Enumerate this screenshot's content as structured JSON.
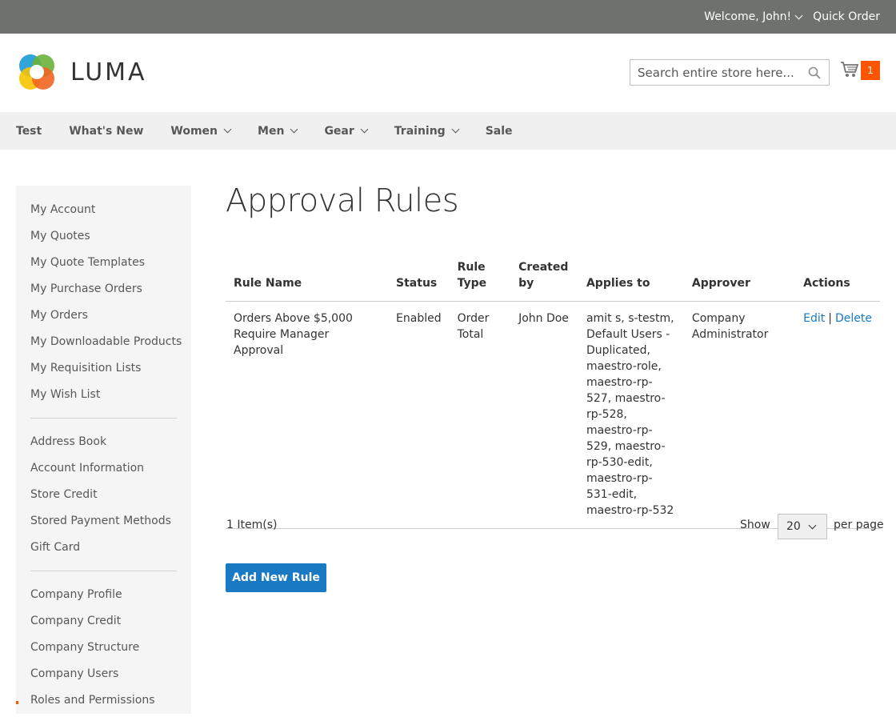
{
  "topbar": {
    "welcome": "Welcome, John!",
    "quick_order": "Quick Order"
  },
  "header": {
    "logo_text": "LUMA",
    "search_placeholder": "Search entire store here...",
    "cart_count": "1"
  },
  "nav": {
    "items": [
      {
        "label": "Test",
        "has_menu": false
      },
      {
        "label": "What's New",
        "has_menu": false
      },
      {
        "label": "Women",
        "has_menu": true
      },
      {
        "label": "Men",
        "has_menu": true
      },
      {
        "label": "Gear",
        "has_menu": true
      },
      {
        "label": "Training",
        "has_menu": true
      },
      {
        "label": "Sale",
        "has_menu": false
      }
    ]
  },
  "sidebar": {
    "group1": [
      "My Account",
      "My Quotes",
      "My Quote Templates",
      "My Purchase Orders",
      "My Orders",
      "My Downloadable Products",
      "My Requisition Lists",
      "My Wish List"
    ],
    "group2": [
      "Address Book",
      "Account Information",
      "Store Credit",
      "Stored Payment Methods",
      "Gift Card"
    ],
    "group3": [
      "Company Profile",
      "Company Credit",
      "Company Structure",
      "Company Users",
      "Roles and Permissions"
    ]
  },
  "main": {
    "title": "Approval Rules",
    "columns": [
      "Rule Name",
      "Status",
      "Rule Type",
      "Created by",
      "Applies to",
      "Approver",
      "Actions"
    ],
    "rows": [
      {
        "rule_name": "Orders Above $5,000 Require Manager Approval",
        "status": "Enabled",
        "rule_type": "Order Total",
        "created_by": "John Doe",
        "applies_to": "amit s, s-testm, Default Users - Duplicated, maestro-role, maestro-rp-527, maestro-rp-528, maestro-rp-529, maestro-rp-530-edit, maestro-rp-531-edit, maestro-rp-532",
        "approver": "Company Administrator",
        "edit": "Edit",
        "separator": "|",
        "delete": "Delete"
      }
    ],
    "items_count": "1 Item(s)",
    "show_label": "Show",
    "limit_value": "20",
    "per_page_label": "per page",
    "add_button": "Add New Rule"
  }
}
